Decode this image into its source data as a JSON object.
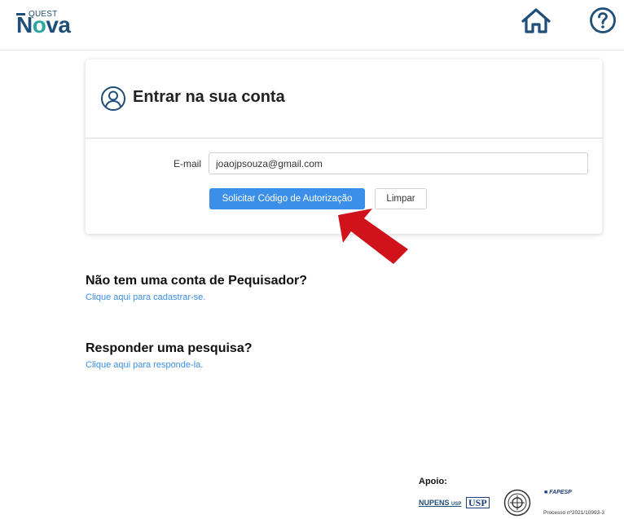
{
  "header": {
    "logo_top": "QUEST",
    "logo_main_pre": "N",
    "logo_main_o": "o",
    "logo_main_post": "va",
    "home_icon": "home-icon",
    "help_icon": "question-circle-icon"
  },
  "login": {
    "title": "Entrar na sua conta",
    "icon": "user-circle-icon",
    "email_label": "E-mail",
    "email_value": "joaojpsouza@gmail.com",
    "request_button": "Solicitar Código de Autorização",
    "clear_button": "Limpar"
  },
  "annotation": {
    "arrow_color": "#d0121a"
  },
  "register": {
    "title": "Não tem uma conta de Pequisador?",
    "link": "Clique aqui para cadastrar-se."
  },
  "respond": {
    "title": "Responder uma pesquisa?",
    "link": "Clique aqui para responde-la."
  },
  "footer": {
    "apoio": "Apoio:",
    "sponsor_1": "NUPENS",
    "sponsor_1_sub": "USP",
    "sponsor_2": "USP",
    "sponsor_4": "FAPESP",
    "processo": "Processo nº2021/10993-3"
  },
  "colors": {
    "brand": "#1f4e79",
    "brand_accent": "#2aa7a1",
    "primary_button": "#3b8fe8",
    "link": "#3b8fe8"
  }
}
